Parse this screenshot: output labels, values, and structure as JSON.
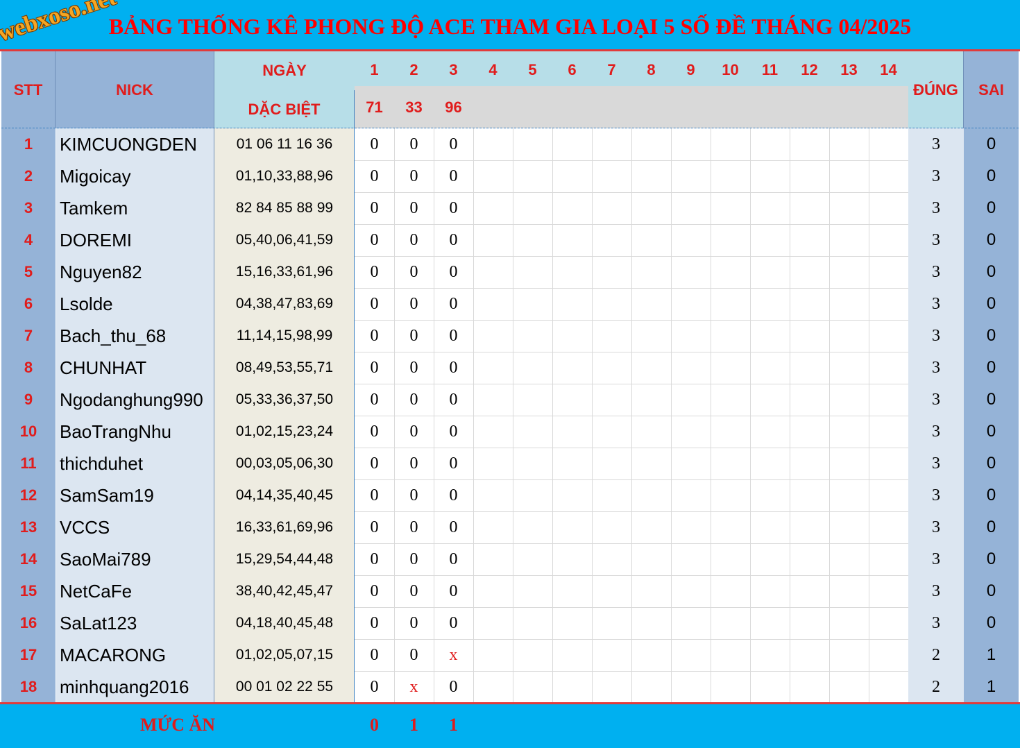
{
  "title": "BẢNG THỐNG KÊ PHONG ĐỘ ACE THAM GIA LOẠI 5 SỐ ĐỀ THÁNG 04/2025",
  "logo_text": "webxoso.net",
  "headers": {
    "stt": "STT",
    "nick": "NICK",
    "ngay": "NGÀY",
    "dac_biet": "DẶC BIỆT",
    "dung": "ĐÚNG",
    "sai": "SAI",
    "days": [
      "1",
      "2",
      "3",
      "4",
      "5",
      "6",
      "7",
      "8",
      "9",
      "10",
      "11",
      "12",
      "13",
      "14"
    ],
    "results": [
      "71",
      "33",
      "96"
    ]
  },
  "rows": [
    {
      "stt": "1",
      "nick": "KIMCUONGDEN",
      "numbers": "01 06 11 16 36",
      "marks": [
        "0",
        "0",
        "0"
      ],
      "dung": "3",
      "sai": "0"
    },
    {
      "stt": "2",
      "nick": "Migoicay",
      "numbers": "01,10,33,88,96",
      "marks": [
        "0",
        "0",
        "0"
      ],
      "dung": "3",
      "sai": "0"
    },
    {
      "stt": "3",
      "nick": "Tamkem",
      "numbers": "82 84 85 88 99",
      "marks": [
        "0",
        "0",
        "0"
      ],
      "dung": "3",
      "sai": "0"
    },
    {
      "stt": "4",
      "nick": "DOREMI",
      "numbers": "05,40,06,41,59",
      "marks": [
        "0",
        "0",
        "0"
      ],
      "dung": "3",
      "sai": "0"
    },
    {
      "stt": "5",
      "nick": "Nguyen82",
      "numbers": "15,16,33,61,96",
      "marks": [
        "0",
        "0",
        "0"
      ],
      "dung": "3",
      "sai": "0"
    },
    {
      "stt": "6",
      "nick": "Lsolde",
      "numbers": "04,38,47,83,69",
      "marks": [
        "0",
        "0",
        "0"
      ],
      "dung": "3",
      "sai": "0"
    },
    {
      "stt": "7",
      "nick": "Bach_thu_68",
      "numbers": "11,14,15,98,99",
      "marks": [
        "0",
        "0",
        "0"
      ],
      "dung": "3",
      "sai": "0"
    },
    {
      "stt": "8",
      "nick": "CHUNHAT",
      "numbers": "08,49,53,55,71",
      "marks": [
        "0",
        "0",
        "0"
      ],
      "dung": "3",
      "sai": "0"
    },
    {
      "stt": "9",
      "nick": "Ngodanghung990",
      "numbers": "05,33,36,37,50",
      "marks": [
        "0",
        "0",
        "0"
      ],
      "dung": "3",
      "sai": "0"
    },
    {
      "stt": "10",
      "nick": "BaoTrangNhu",
      "numbers": "01,02,15,23,24",
      "marks": [
        "0",
        "0",
        "0"
      ],
      "dung": "3",
      "sai": "0"
    },
    {
      "stt": "11",
      "nick": "thichduhet",
      "numbers": "00,03,05,06,30",
      "marks": [
        "0",
        "0",
        "0"
      ],
      "dung": "3",
      "sai": "0"
    },
    {
      "stt": "12",
      "nick": "SamSam19",
      "numbers": "04,14,35,40,45",
      "marks": [
        "0",
        "0",
        "0"
      ],
      "dung": "3",
      "sai": "0"
    },
    {
      "stt": "13",
      "nick": "VCCS",
      "numbers": "16,33,61,69,96",
      "marks": [
        "0",
        "0",
        "0"
      ],
      "dung": "3",
      "sai": "0"
    },
    {
      "stt": "14",
      "nick": "SaoMai789",
      "numbers": "15,29,54,44,48",
      "marks": [
        "0",
        "0",
        "0"
      ],
      "dung": "3",
      "sai": "0"
    },
    {
      "stt": "15",
      "nick": "NetCaFe",
      "numbers": "38,40,42,45,47",
      "marks": [
        "0",
        "0",
        "0"
      ],
      "dung": "3",
      "sai": "0"
    },
    {
      "stt": "16",
      "nick": "SaLat123",
      "numbers": "04,18,40,45,48",
      "marks": [
        "0",
        "0",
        "0"
      ],
      "dung": "3",
      "sai": "0"
    },
    {
      "stt": "17",
      "nick": "MACARONG",
      "numbers": "01,02,05,07,15",
      "marks": [
        "0",
        "0",
        "x"
      ],
      "dung": "2",
      "sai": "1"
    },
    {
      "stt": "18",
      "nick": "minhquang2016",
      "numbers": "00 01 02 22 55",
      "marks": [
        "0",
        "x",
        "0"
      ],
      "dung": "2",
      "sai": "1"
    }
  ],
  "footer": {
    "label": "MỨC ĂN",
    "values": [
      "0",
      "1",
      "1"
    ]
  },
  "colors": {
    "title_bg": "#00b0f0",
    "accent_red": "#e01c1c",
    "stt_bg": "#95b3d7",
    "nick_bg": "#dce6f1",
    "numbers_bg": "#eeece1",
    "header_light": "#b7dee8",
    "header_gray": "#d9d9d9"
  }
}
